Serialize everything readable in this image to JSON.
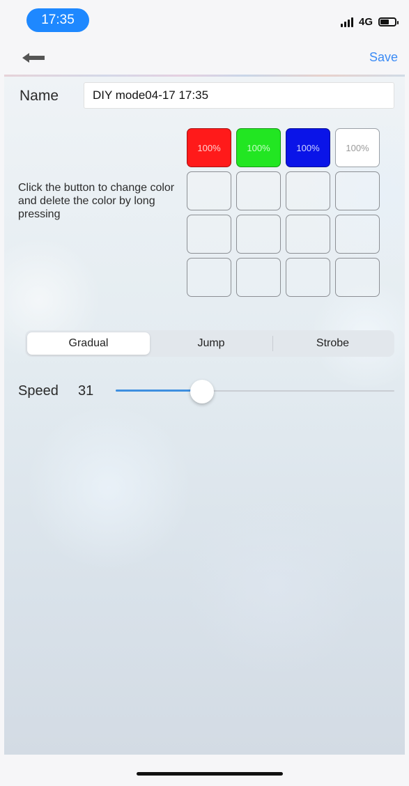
{
  "status_bar": {
    "time": "17:35",
    "network": "4G",
    "icons": [
      "signal-icon",
      "battery-icon"
    ]
  },
  "nav": {
    "back_icon": "back-arrow-icon",
    "save_label": "Save"
  },
  "form": {
    "name_label": "Name",
    "name_value": "DIY mode04-17 17:35"
  },
  "colors": {
    "hint": "Click the button to change color and delete the color by long pressing",
    "slots": [
      {
        "color": "#ff1a1a",
        "label": "100%",
        "text_color": "#ffd0d0"
      },
      {
        "color": "#22e622",
        "label": "100%",
        "text_color": "#c8ffc8"
      },
      {
        "color": "#0a14e8",
        "label": "100%",
        "text_color": "#d0d4ff"
      },
      {
        "color": "#ffffff",
        "label": "100%",
        "text_color": "#9a9a9a"
      },
      null,
      null,
      null,
      null,
      null,
      null,
      null,
      null,
      null,
      null,
      null,
      null
    ]
  },
  "modes": {
    "options": [
      "Gradual",
      "Jump",
      "Strobe"
    ],
    "selected": "Gradual"
  },
  "speed": {
    "label": "Speed",
    "value": "31",
    "level_percent": 31
  },
  "theme": {
    "accent": "#3b8bf5",
    "slider_fill": "#3e8fe0",
    "time_pill": "#1e88ff"
  }
}
